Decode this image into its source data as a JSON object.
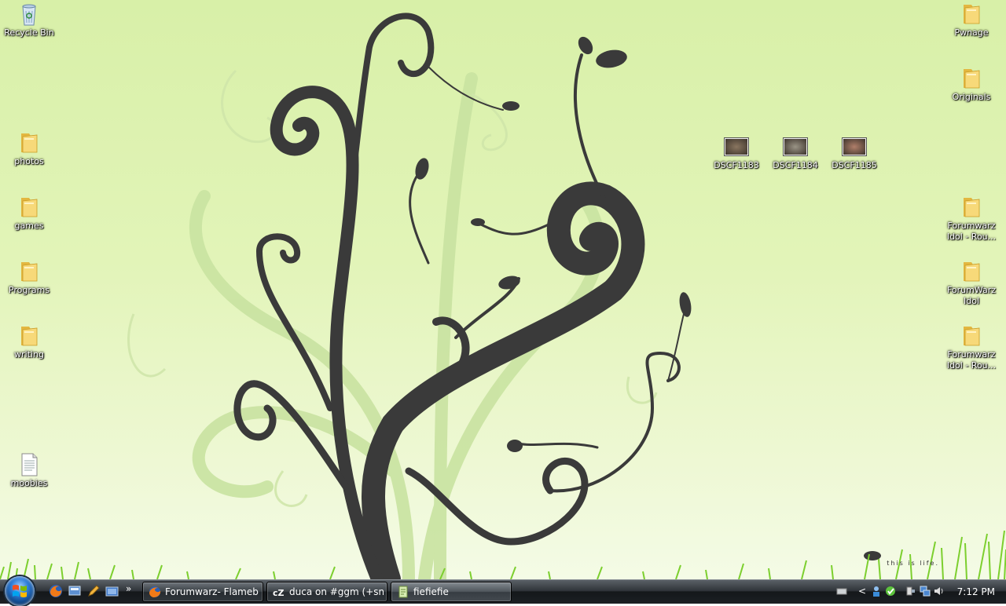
{
  "desktop": {
    "icons_left": [
      {
        "label": "Recycle Bin",
        "icon": "recycle-bin-icon"
      },
      {
        "label": "photos",
        "icon": "folder-icon"
      },
      {
        "label": "games",
        "icon": "folder-icon"
      },
      {
        "label": "Programs",
        "icon": "folder-icon"
      },
      {
        "label": "writing",
        "icon": "folder-icon"
      },
      {
        "label": "moobies",
        "icon": "text-file-icon"
      }
    ],
    "icons_right": [
      {
        "label": "Pwnage",
        "icon": "folder-icon"
      },
      {
        "label": "Originals",
        "icon": "folder-icon"
      },
      {
        "label": "Forumwarz Idol - Rou...",
        "icon": "folder-icon"
      },
      {
        "label": "ForumWarz Idol",
        "icon": "folder-icon"
      },
      {
        "label": "Forumwarz Idol - Rou...",
        "icon": "folder-icon"
      }
    ],
    "image_files": [
      {
        "label": "DSCF1183",
        "icon": "image-file-icon"
      },
      {
        "label": "DSCF1184",
        "icon": "image-file-icon"
      },
      {
        "label": "DSCF1185",
        "icon": "image-file-icon"
      }
    ],
    "wallpaper_text": "this is life.",
    "colors": {
      "wallpaper_green": "#dff3b3",
      "tree": "#3a3a3a",
      "grass": "#7ccf2e"
    }
  },
  "taskbar": {
    "start_icon": "windows-start-orb",
    "quick_launch": [
      {
        "name": "firefox-icon"
      },
      {
        "name": "show-desktop-icon"
      },
      {
        "name": "pencil-app-icon"
      },
      {
        "name": "switch-windows-icon"
      }
    ],
    "overflow": "»",
    "tasks": [
      {
        "label": "Forumwarz- Flameb...",
        "icon": "firefox-icon",
        "active": false
      },
      {
        "label": "duca on #ggm (+sn...",
        "icon": "chatzilla-icon",
        "active": false
      },
      {
        "label": "fiefiefie",
        "icon": "notepad-icon",
        "active": true
      }
    ],
    "tray_icons": [
      "keyboard-icon",
      "show-hidden-icon",
      "network-user-icon",
      "messenger-icon",
      "safely-remove-icon",
      "network-icon",
      "volume-icon"
    ],
    "clock": "7:12 PM"
  }
}
